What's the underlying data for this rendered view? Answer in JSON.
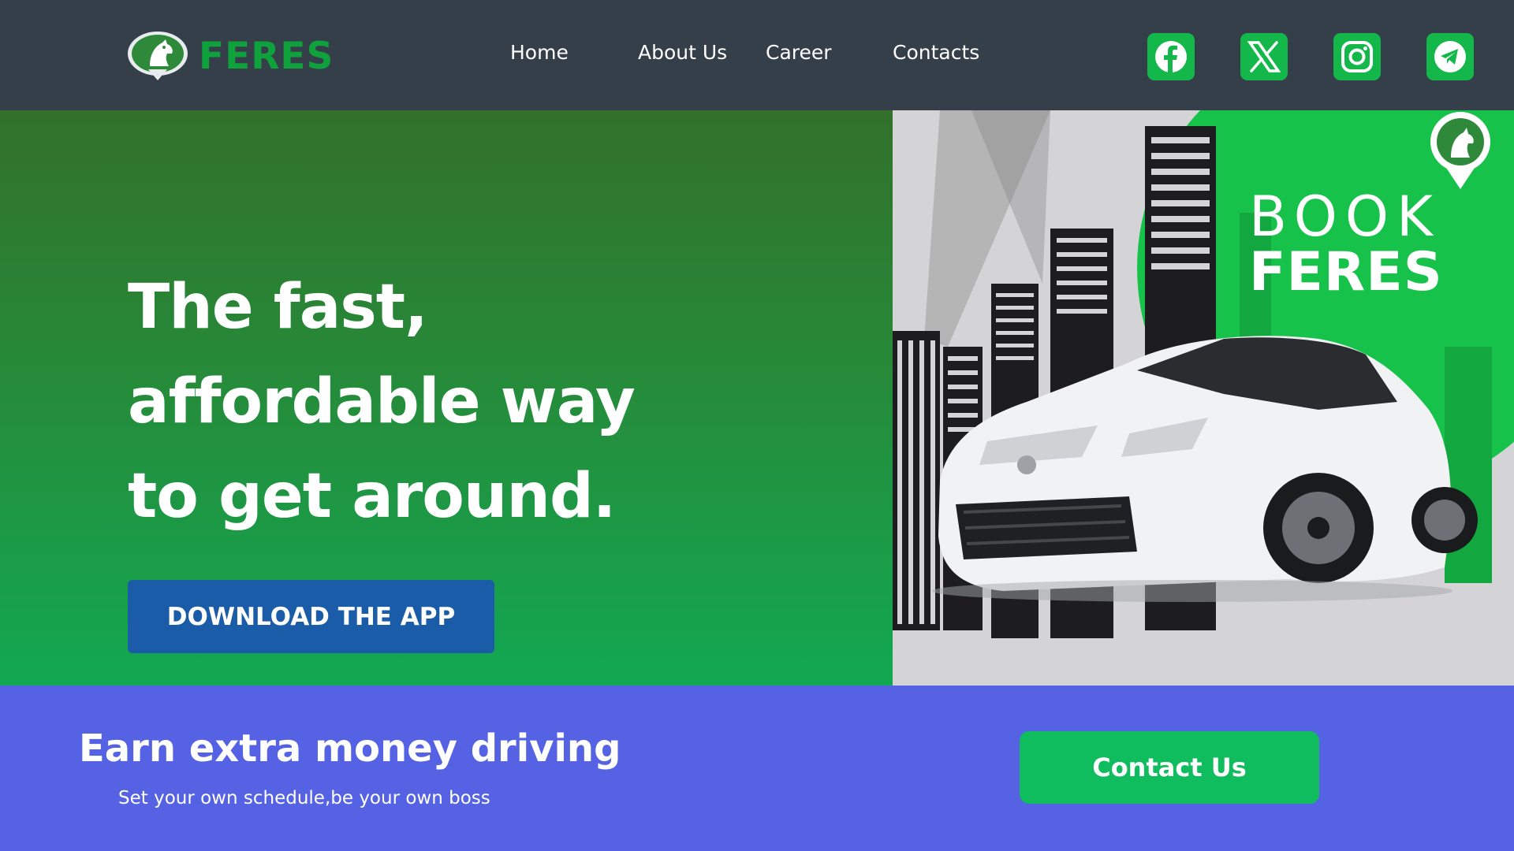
{
  "brand": {
    "name": "FERES",
    "logo_icon": "horse-head-pin-icon",
    "color": "#0fa23c"
  },
  "nav": {
    "items": [
      {
        "label": "Home"
      },
      {
        "label": "About Us"
      },
      {
        "label": "Career"
      },
      {
        "label": "Contacts"
      }
    ]
  },
  "social": {
    "items": [
      {
        "icon": "facebook-icon"
      },
      {
        "icon": "x-twitter-icon"
      },
      {
        "icon": "instagram-icon"
      },
      {
        "icon": "telegram-icon"
      }
    ],
    "color": "#14b84a"
  },
  "hero": {
    "title_lines": [
      "The fast,",
      "affordable way",
      "to get around."
    ],
    "cta_label": "DOWNLOAD THE APP",
    "cta_color": "#1a5ca8",
    "promo": {
      "line1": "BOOK",
      "line2": "FERES"
    }
  },
  "band": {
    "title": "Earn extra money driving",
    "subtitle": "Set your own schedule,be your own boss",
    "cta_label": "Contact Us",
    "background": "#5562e3",
    "cta_color": "#10bd5e"
  }
}
